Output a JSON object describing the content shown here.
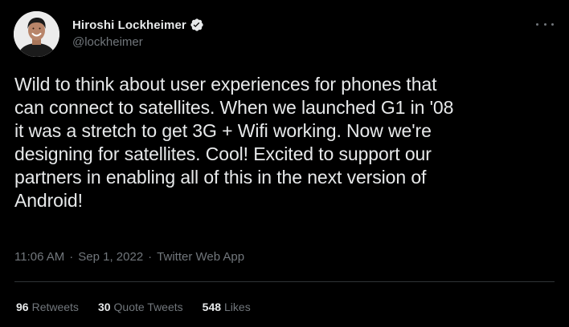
{
  "tweet": {
    "author": {
      "display_name": "Hiroshi Lockheimer",
      "handle": "@lockheimer",
      "verified": true
    },
    "text": "Wild to think about user experiences for phones that\ncan connect to satellites. When we launched G1 in '08\nit was a stretch to get 3G + Wifi working. Now we're\ndesigning for satellites. Cool! Excited to support our\npartners in enabling all of this in the next version of\nAndroid!",
    "time": "11:06 AM",
    "date": "Sep 1, 2022",
    "separator": "·",
    "source": "Twitter Web App",
    "stats": {
      "retweets": {
        "count": "96",
        "label": "Retweets"
      },
      "quote_tweets": {
        "count": "30",
        "label": "Quote Tweets"
      },
      "likes": {
        "count": "548",
        "label": "Likes"
      }
    }
  },
  "colors": {
    "background": "#000000",
    "text": "#e7e9ea",
    "secondary": "#71767b",
    "divider": "#2f3336",
    "verified_badge": "#e7e9ea"
  }
}
